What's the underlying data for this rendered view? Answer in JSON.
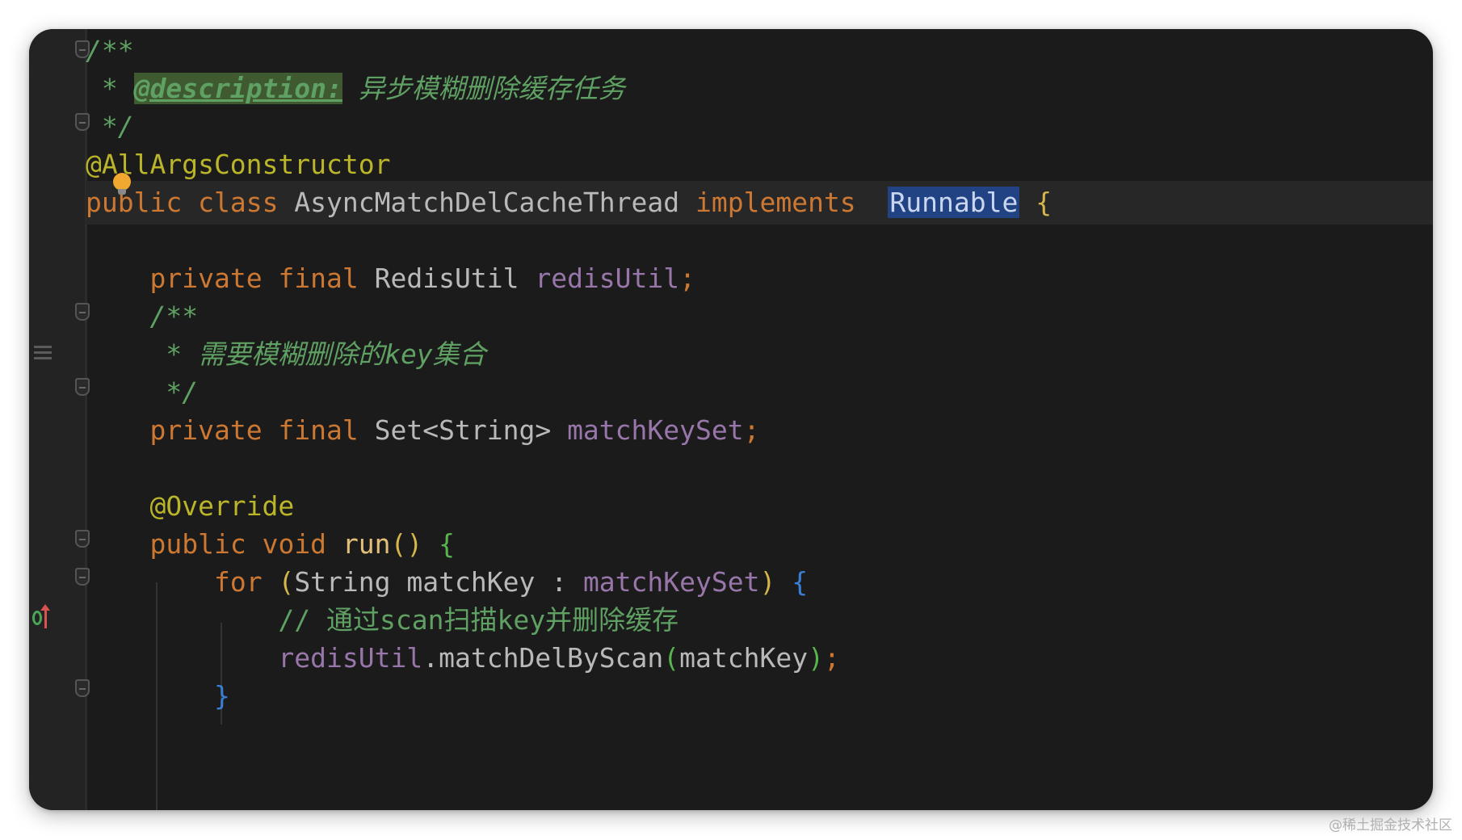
{
  "editor": {
    "lines": [
      {
        "tokens": [
          {
            "t": "/**",
            "c": "doc"
          }
        ]
      },
      {
        "tokens": [
          {
            "t": " * ",
            "c": "doc"
          },
          {
            "t": "@description:",
            "c": "doc-tag"
          },
          {
            "t": " 异步模糊删除缓存任务",
            "c": "doc"
          }
        ]
      },
      {
        "tokens": [
          {
            "t": " */",
            "c": "doc"
          }
        ]
      },
      {
        "tokens": [
          {
            "t": "@AllArgsConstructor",
            "c": "ann"
          }
        ]
      },
      {
        "tokens": [
          {
            "t": "public",
            "c": "kw"
          },
          {
            "t": " ",
            "c": "plain"
          },
          {
            "t": "class",
            "c": "kw"
          },
          {
            "t": " AsyncMatchDelCacheThread ",
            "c": "cls"
          },
          {
            "t": "implements",
            "c": "kw"
          },
          {
            "t": "  ",
            "c": "plain"
          },
          {
            "t": "Runnable",
            "c": "hl-runnable"
          },
          {
            "t": " ",
            "c": "plain"
          },
          {
            "t": "{",
            "c": "brace-y"
          }
        ]
      },
      {
        "tokens": []
      },
      {
        "tokens": [
          {
            "t": "    ",
            "c": "plain"
          },
          {
            "t": "private",
            "c": "kw"
          },
          {
            "t": " ",
            "c": "plain"
          },
          {
            "t": "final",
            "c": "kw"
          },
          {
            "t": " RedisUtil ",
            "c": "cls"
          },
          {
            "t": "redisUtil",
            "c": "fld"
          },
          {
            "t": ";",
            "c": "punc"
          }
        ]
      },
      {
        "tokens": [
          {
            "t": "    /**",
            "c": "doc"
          }
        ]
      },
      {
        "tokens": [
          {
            "t": "     * 需要模糊删除的key集合",
            "c": "doc"
          }
        ]
      },
      {
        "tokens": [
          {
            "t": "     */",
            "c": "doc"
          }
        ]
      },
      {
        "tokens": [
          {
            "t": "    ",
            "c": "plain"
          },
          {
            "t": "private",
            "c": "kw"
          },
          {
            "t": " ",
            "c": "plain"
          },
          {
            "t": "final",
            "c": "kw"
          },
          {
            "t": " Set<String> ",
            "c": "cls"
          },
          {
            "t": "matchKeySet",
            "c": "fld"
          },
          {
            "t": ";",
            "c": "punc"
          }
        ]
      },
      {
        "tokens": []
      },
      {
        "tokens": [
          {
            "t": "    @Override",
            "c": "ann"
          }
        ]
      },
      {
        "tokens": [
          {
            "t": "    ",
            "c": "plain"
          },
          {
            "t": "public",
            "c": "kw"
          },
          {
            "t": " ",
            "c": "plain"
          },
          {
            "t": "void",
            "c": "kw"
          },
          {
            "t": " ",
            "c": "plain"
          },
          {
            "t": "run",
            "c": "method"
          },
          {
            "t": "()",
            "c": "brace-y"
          },
          {
            "t": " ",
            "c": "plain"
          },
          {
            "t": "{",
            "c": "brace-g"
          }
        ]
      },
      {
        "tokens": [
          {
            "t": "        ",
            "c": "plain"
          },
          {
            "t": "for",
            "c": "kw"
          },
          {
            "t": " ",
            "c": "plain"
          },
          {
            "t": "(",
            "c": "brace-y"
          },
          {
            "t": "String matchKey : ",
            "c": "cls"
          },
          {
            "t": "matchKeySet",
            "c": "fld"
          },
          {
            "t": ")",
            "c": "brace-y"
          },
          {
            "t": " ",
            "c": "plain"
          },
          {
            "t": "{",
            "c": "brace-b"
          }
        ]
      },
      {
        "tokens": [
          {
            "t": "            // 通过scan扫描key并删除缓存",
            "c": "cmt"
          }
        ]
      },
      {
        "tokens": [
          {
            "t": "            ",
            "c": "plain"
          },
          {
            "t": "redisUtil",
            "c": "fld"
          },
          {
            "t": ".matchDelByScan",
            "c": "cls"
          },
          {
            "t": "(",
            "c": "brace-gn"
          },
          {
            "t": "matchKey",
            "c": "cls"
          },
          {
            "t": ")",
            "c": "brace-gn"
          },
          {
            "t": ";",
            "c": "punc"
          }
        ]
      },
      {
        "tokens": [
          {
            "t": "        ",
            "c": "plain"
          },
          {
            "t": "}",
            "c": "brace-b"
          }
        ]
      }
    ]
  },
  "watermark": "@稀土掘金技术社区"
}
